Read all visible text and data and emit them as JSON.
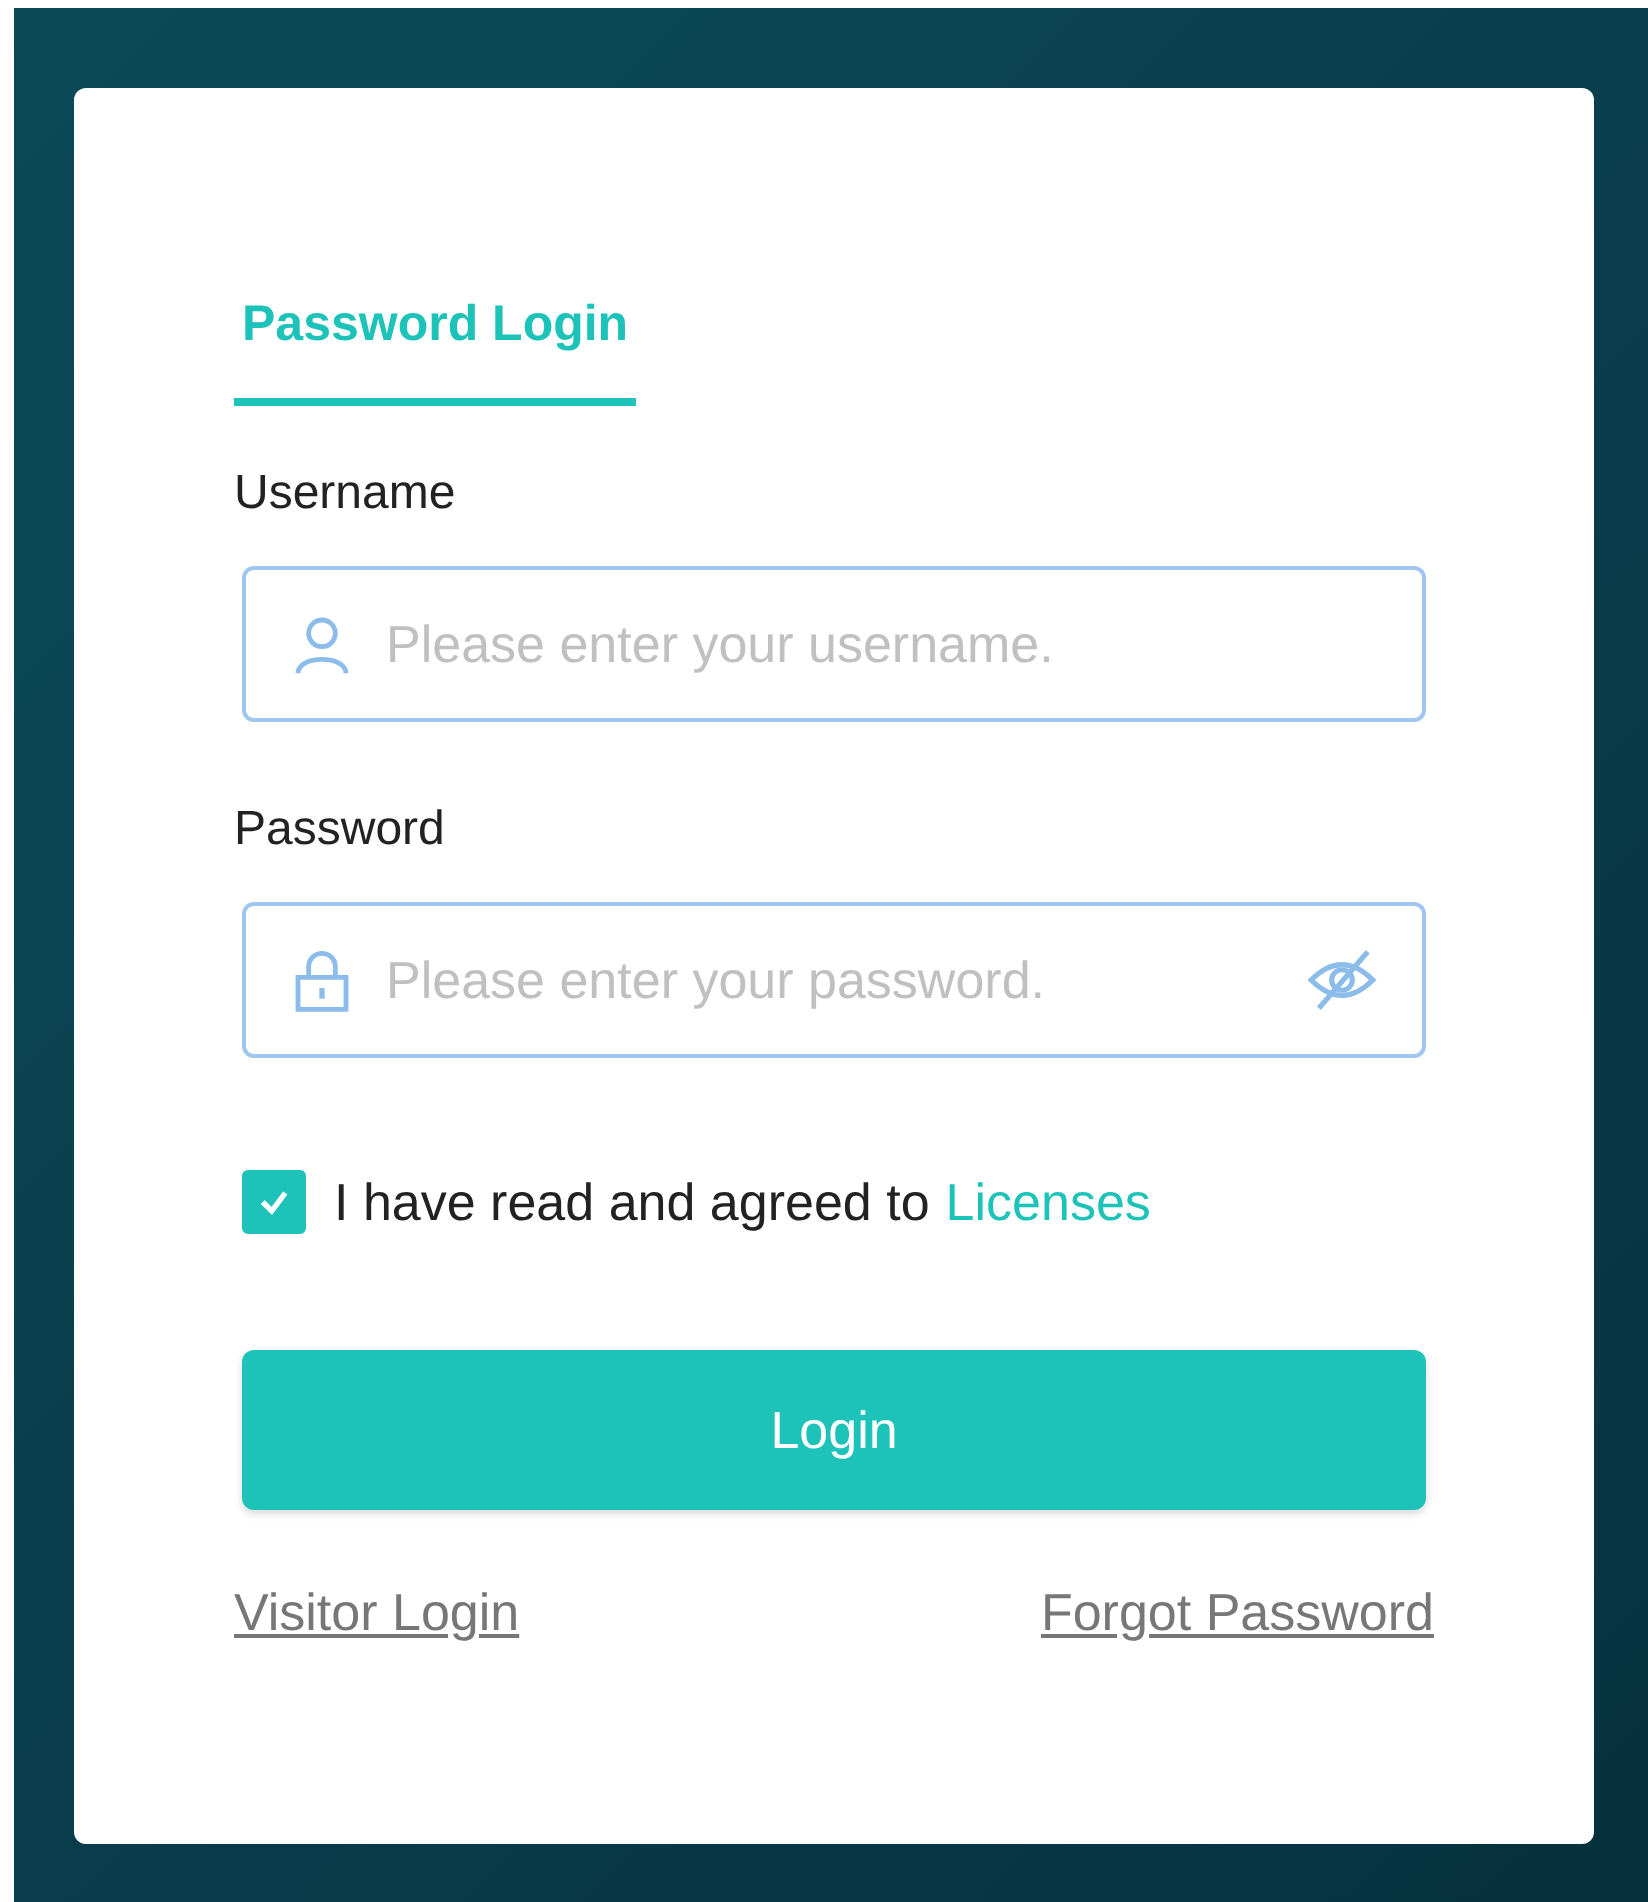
{
  "tabs": [
    {
      "label": "Password Login",
      "selected": true
    }
  ],
  "username": {
    "label": "Username",
    "placeholder": "Please enter your username."
  },
  "password": {
    "label": "Password",
    "placeholder": "Please enter your password."
  },
  "agreement": {
    "checked": true,
    "text": "I have read and agreed to",
    "link": "Licenses"
  },
  "login_button": "Login",
  "links": {
    "visitor": "Visitor Login",
    "forgot": "Forgot Password"
  }
}
